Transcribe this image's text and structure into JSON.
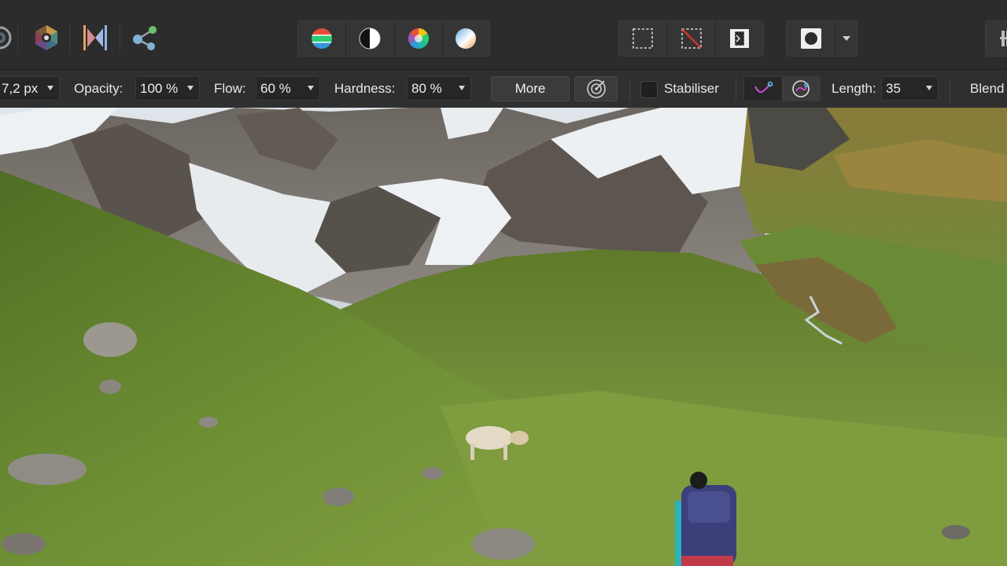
{
  "toolbar": {
    "personas": [
      {
        "name": "photo-persona"
      },
      {
        "name": "develop-persona"
      },
      {
        "name": "tone-mapping-persona"
      },
      {
        "name": "export-persona"
      }
    ],
    "adjust_group": [
      "levels-icon",
      "contrast-icon",
      "hue-wheel-icon",
      "white-balance-icon"
    ],
    "selection_group": [
      "marquee-selection-icon",
      "deselect-icon",
      "invert-selection-icon"
    ],
    "mask_group": [
      "quick-mask-icon",
      "mask-dropdown-arrow"
    ]
  },
  "context": {
    "width_value": "7,2 px",
    "opacity_label": "Opacity:",
    "opacity_value": "100 %",
    "flow_label": "Flow:",
    "flow_value": "60 %",
    "hardness_label": "Hardness:",
    "hardness_value": "80 %",
    "more_label": "More",
    "stabiliser_label": "Stabiliser",
    "length_label": "Length:",
    "length_value": "35",
    "blend_label": "Blend"
  },
  "colors": {
    "toolbar_bg": "#2c2c2c",
    "context_bg": "#2f2f2f",
    "field_bg": "#262626",
    "accent_magenta": "#d04bd6",
    "accent_cyan": "#4fc3e8"
  },
  "canvas": {
    "description_icon": "landscape-photo"
  }
}
